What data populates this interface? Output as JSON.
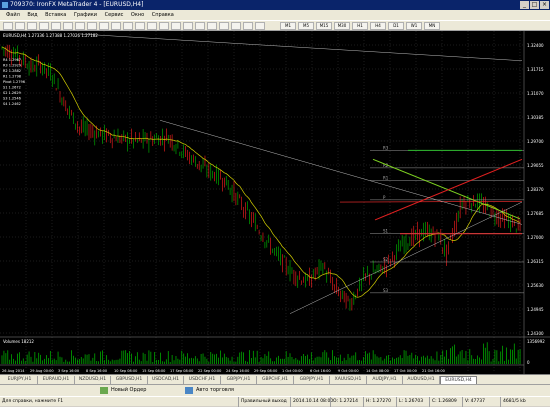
{
  "window": {
    "title": "709370: IronFX MetaTrader 4 - [EURUSD,H4]"
  },
  "menu": [
    "Файл",
    "Вид",
    "Вставка",
    "Графики",
    "Сервис",
    "Окно",
    "Справка"
  ],
  "timeframes": [
    "M1",
    "M5",
    "M15",
    "M30",
    "H1",
    "H4",
    "D1",
    "W1",
    "MN"
  ],
  "chart": {
    "header": "EURUSD,H4  1.27336 1.27388 1.27026 1.27182",
    "pivots": [
      "R4 1.2967",
      "R3 1.2929",
      "R2 1.2882",
      "R1 1.2798",
      "Pivot 1.2796",
      "S1 1.2672",
      "S2 1.2629",
      "S3 1.2546",
      "S4 1.2462"
    ],
    "price_labels": [
      "1.32400",
      "1.31715",
      "1.31070",
      "1.30385",
      "1.29700",
      "1.29055",
      "1.28370",
      "1.27685",
      "1.27000",
      "1.26315",
      "1.25630",
      "1.24945",
      "1.24300"
    ],
    "level_labels": [
      "R3",
      "R2",
      "R1",
      "P",
      "S1",
      "S2",
      "S3"
    ],
    "date_labels": [
      "26 Aug 2014",
      "29 Aug 00:00",
      "3 Sep 16:00",
      "8 Sep 16:00",
      "10 Sep 08:00",
      "15 Sep 08:00",
      "17 Sep 08:00",
      "22 Sep 00:00",
      "24 Sep 16:00",
      "29 Sep 08:00",
      "1 Oct 00:00",
      "6 Oct 16:00",
      "9 Oct 00:00",
      "14 Oct 08:00",
      "17 Oct 00:00",
      "21 Oct 16:00"
    ],
    "volume_label": "Volumes 18212",
    "volume_axis": [
      "1356992",
      "0"
    ]
  },
  "tabs": [
    "EURJPY,H1",
    "EURAUD,H1",
    "NZDUSD,H1",
    "GBPUSD,H1",
    "USDCAD,H1",
    "USDCHF,H1",
    "GBPJPY,H1",
    "GBPCHF,H1",
    "GBPJPY,H1",
    "XAUUSD,H1",
    "AUDJPY,H1",
    "AUDUSD,H1",
    "EURUSD,H4"
  ],
  "navbar": {
    "new_order": "Новый Ордер",
    "auto_trading": "Авто торговля"
  },
  "status": {
    "help": "Для справки, нажмите F1",
    "profile": "Правильный выход",
    "datetime": "2014.10.14 08:00",
    "open": "O: 1.27214",
    "high": "H: 1.27270",
    "low": "L: 1.26703",
    "close": "C: 1.26809",
    "volume": "V: 47737",
    "traffic": "4681/5 kb"
  }
}
